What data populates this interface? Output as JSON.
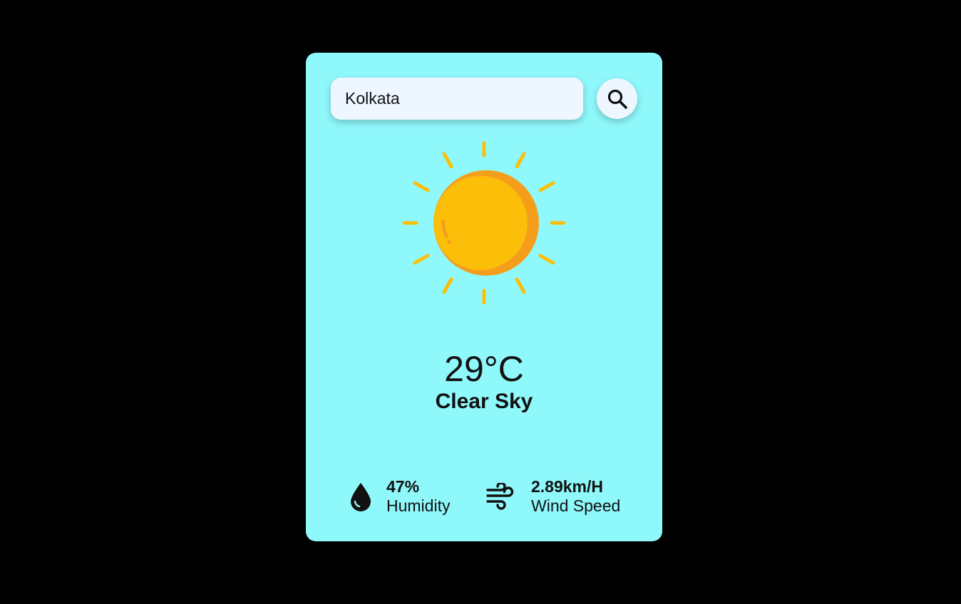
{
  "search": {
    "value": "Kolkata",
    "placeholder": "",
    "button_icon": "search-icon"
  },
  "weather": {
    "icon": "sun-icon",
    "temperature": "29°C",
    "condition": "Clear Sky"
  },
  "stats": {
    "humidity": {
      "icon": "water-drop-icon",
      "value": "47%",
      "label": "Humidity"
    },
    "wind": {
      "icon": "wind-icon",
      "value": "2.89km/H",
      "label": "Wind Speed"
    }
  },
  "colors": {
    "page_background": "#000000",
    "card_background": "#8ff8fb",
    "input_background": "#eef6ff",
    "sun_core": "#fbbf0a",
    "sun_shade": "#f59e1c",
    "sun_rays": "#fbbf0a",
    "text": "#111111"
  }
}
